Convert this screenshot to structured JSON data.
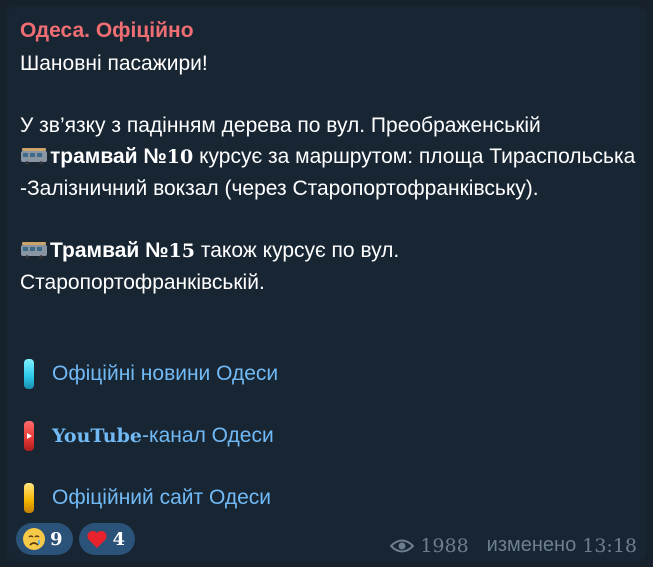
{
  "channel": {
    "name": "Одеса. Офіційно"
  },
  "message": {
    "greeting": "Шановні пасажири!",
    "line1": "У зв’язку  з падінням дерева по вул. Преображенській",
    "p1_bold_a": "трамвай №",
    "p1_num": "10",
    "p1_rest": " курсує за маршрутом: площа Тираспольська -Залізничний вокзал (через Старопортофранківську).",
    "p2_bold_a": "Трамвай №",
    "p2_num": "15",
    "p2_rest": " також курсує по вул. Старопортофранківській."
  },
  "links": [
    {
      "label": "Офіційні новини Одеси",
      "icon": "cyan-bar-icon",
      "color": "#29c7e8"
    },
    {
      "label_a": "YouTube",
      "label_b": "-канал Одеси",
      "icon": "youtube-bar-icon",
      "color": "#e53935"
    },
    {
      "label": "Офіційний сайт Одеси",
      "icon": "gold-bar-icon",
      "color": "#f5b400"
    }
  ],
  "reactions": [
    {
      "emoji": "crying-face-icon",
      "count": "9"
    },
    {
      "emoji": "red-heart-icon",
      "count": "4"
    }
  ],
  "meta": {
    "views": "1988",
    "edited_label": "изменено",
    "time": "13:18"
  },
  "colors": {
    "background": "#17212b",
    "bubble": "#182533",
    "link": "#71baf6",
    "channel": "#ef6e73"
  }
}
